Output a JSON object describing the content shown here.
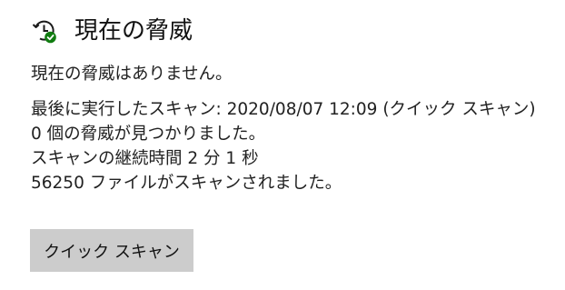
{
  "section": {
    "title": "現在の脅威",
    "icon": "clock-refresh-check-icon",
    "accent_color": "#107c10"
  },
  "status": {
    "no_threats": "現在の脅威はありません。",
    "last_scan": "最後に実行したスキャン: 2020/08/07 12:09 (クイック スキャン)",
    "threats_found": "0 個の脅威が見つかりました。",
    "scan_duration": "スキャンの継続時間 2 分 1 秒",
    "files_scanned": "56250 ファイルがスキャンされました。"
  },
  "actions": {
    "quick_scan_label": "クイック スキャン"
  }
}
